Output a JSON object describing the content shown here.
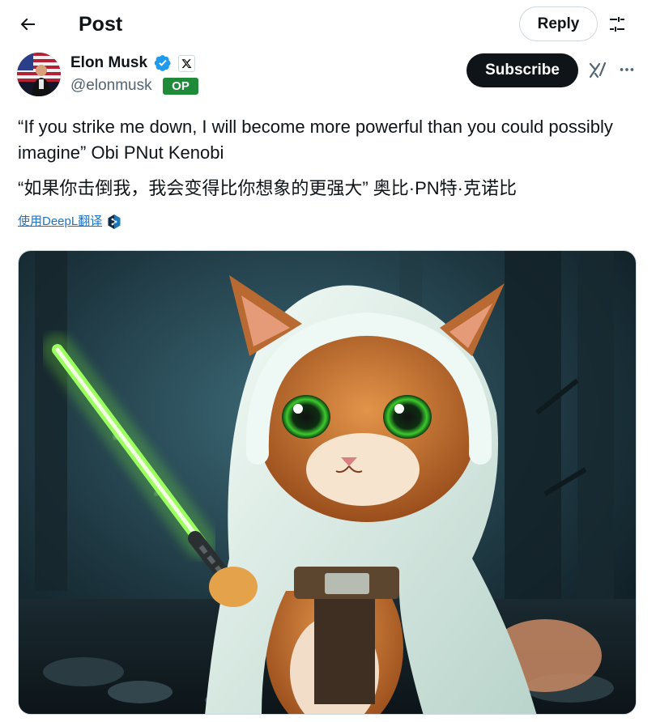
{
  "header": {
    "title": "Post",
    "reply_label": "Reply"
  },
  "author": {
    "name": "Elon Musk",
    "handle": "@elonmusk",
    "op_label": "OP",
    "subscribe_label": "Subscribe"
  },
  "post": {
    "text": "“If you strike me down, I will become more powerful than you could possibly imagine” Obi PNut Kenobi",
    "translation": "“如果你击倒我，我会变得比你想象的更强大” 奥比·PN特·克诺比",
    "translate_link": "使用DeepL翻译"
  },
  "media": {
    "subject": "squirrel in white hooded Jedi cloak holding a green lightsaber in a dark forest"
  },
  "colors": {
    "accent_blue": "#1d9bf0",
    "op_green": "#1f8a3a",
    "text_primary": "#0f1419",
    "text_secondary": "#536471",
    "lightsaber_green": "#7dff3a"
  },
  "icons": {
    "back": "arrow-left-icon",
    "filter": "sliders-icon",
    "verified": "verified-badge-icon",
    "x_logo": "x-logo-icon",
    "grok": "grok-icon",
    "more": "more-dots-icon",
    "deepl": "deepl-icon"
  }
}
